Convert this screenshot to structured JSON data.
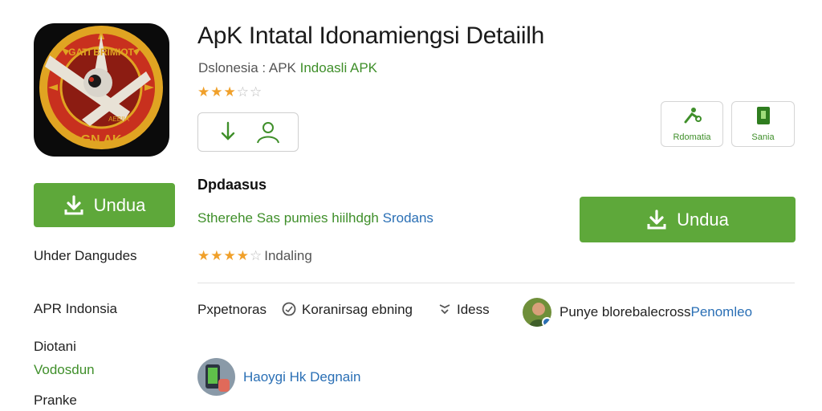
{
  "app": {
    "icon_name": "app-emblem-icon",
    "icon_text_top": "GATI BRIMIOT",
    "icon_text_mid": "AEBIIA",
    "icon_text_bottom": "GN AK",
    "title": "ApK Intatal Idonamiengsi Detaiilh",
    "subtitle_prefix": "Dslonesia : APK ",
    "subtitle_accent": "Indoasli APK",
    "rating_top": {
      "on": "★★★",
      "off": "☆☆"
    }
  },
  "actions": {
    "download_icon": "download-arrow-icon",
    "user_icon": "user-icon"
  },
  "tiles": [
    {
      "label": "Rdomatia",
      "icon": "share-icon"
    },
    {
      "label": "Sania",
      "icon": "document-icon"
    }
  ],
  "buttons": {
    "download_left": "Undua",
    "download_right": "Undua"
  },
  "section": {
    "heading": "Dpdaasus",
    "link_green": "Stherehe Sas pumies hiilhdgh",
    "link_blue": "Srodans",
    "rating": {
      "on": "★★★★",
      "off": "☆",
      "text": "Indaling"
    }
  },
  "left_column": [
    "Uhder Dangudes",
    "APR Indonsia",
    "Diotani",
    "Vodosdun",
    "Pranke"
  ],
  "meta": {
    "item1": "Pxpetnoras",
    "item2": "Koranirsag ebning",
    "item3": "Idess",
    "item4_text": "Punye blorebalecross ",
    "item4_link": "Penomleo"
  },
  "developer": {
    "name": "Haoygi Hk Degnain"
  },
  "colors": {
    "accent_green": "#5ea83a",
    "link_blue": "#2a6fb5",
    "star": "#f0a02a"
  }
}
